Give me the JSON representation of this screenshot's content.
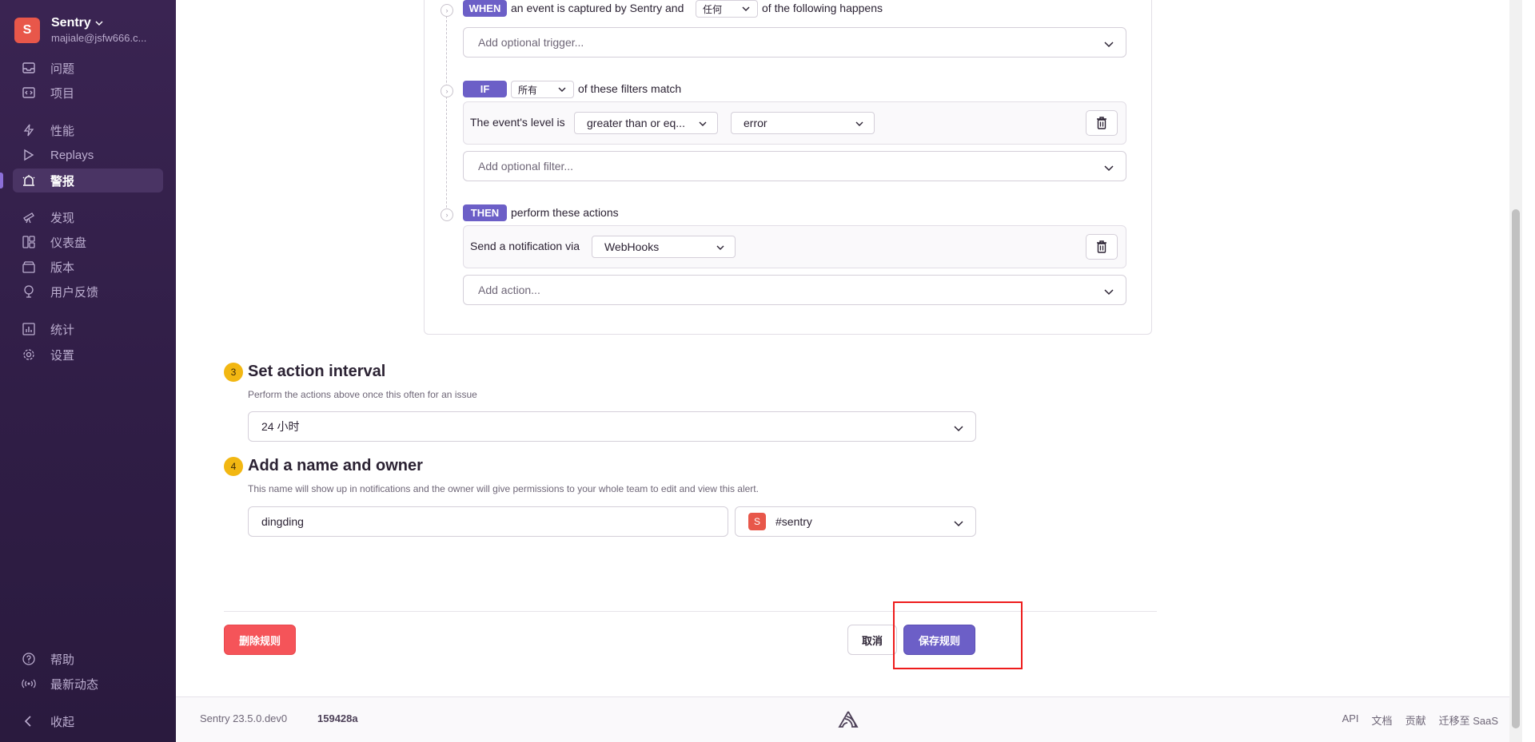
{
  "sidebar": {
    "org_initial": "S",
    "org_name": "Sentry",
    "org_email": "majiale@jsfw666.c...",
    "items": [
      {
        "label": "问题",
        "icon": "inbox-icon"
      },
      {
        "label": "项目",
        "icon": "project-icon"
      },
      {
        "label": "性能",
        "icon": "lightning-icon"
      },
      {
        "label": "Replays",
        "icon": "play-icon"
      },
      {
        "label": "警报",
        "icon": "siren-icon"
      },
      {
        "label": "发现",
        "icon": "telescope-icon"
      },
      {
        "label": "仪表盘",
        "icon": "dashboard-icon"
      },
      {
        "label": "版本",
        "icon": "package-icon"
      },
      {
        "label": "用户反馈",
        "icon": "megaphone-icon"
      },
      {
        "label": "统计",
        "icon": "stats-icon"
      },
      {
        "label": "设置",
        "icon": "gear-icon"
      }
    ],
    "bottom": [
      {
        "label": "帮助",
        "icon": "help-icon"
      },
      {
        "label": "最新动态",
        "icon": "broadcast-icon"
      },
      {
        "label": "收起",
        "icon": "chevron-left-icon"
      }
    ]
  },
  "conditions": {
    "when_badge": "WHEN",
    "when_text_before": "an event is captured by Sentry and",
    "when_match": "任何",
    "when_text_after": "of the following happens",
    "trigger_placeholder": "Add optional trigger...",
    "if_badge": "IF",
    "if_match": "所有",
    "if_text_after": "of these filters match",
    "filter_label": "The event's level is",
    "filter_operator": "greater than or eq...",
    "filter_level": "error",
    "filter_placeholder": "Add optional filter...",
    "then_badge": "THEN",
    "then_text": "perform these actions",
    "action_label": "Send a notification via",
    "action_service": "WebHooks",
    "action_placeholder": "Add action..."
  },
  "interval": {
    "step": "3",
    "title": "Set action interval",
    "hint": "Perform the actions above once this often for an issue",
    "value": "24 小时"
  },
  "name_owner": {
    "step": "4",
    "title": "Add a name and owner",
    "hint": "This name will show up in notifications and the owner will give permissions to your whole team to edit and view this alert.",
    "name_value": "dingding",
    "team_initial": "S",
    "team": "#sentry"
  },
  "buttons": {
    "delete": "删除规则",
    "cancel": "取消",
    "save": "保存规则"
  },
  "footer": {
    "version": "Sentry 23.5.0.dev0",
    "hash": "159428a",
    "links": [
      "API",
      "文档",
      "贡献",
      "迁移至 SaaS"
    ]
  },
  "colors": {
    "accent": "#6c5fc7",
    "danger": "#f55459",
    "step": "#f2b712",
    "sidebar": "#2f1d45"
  }
}
